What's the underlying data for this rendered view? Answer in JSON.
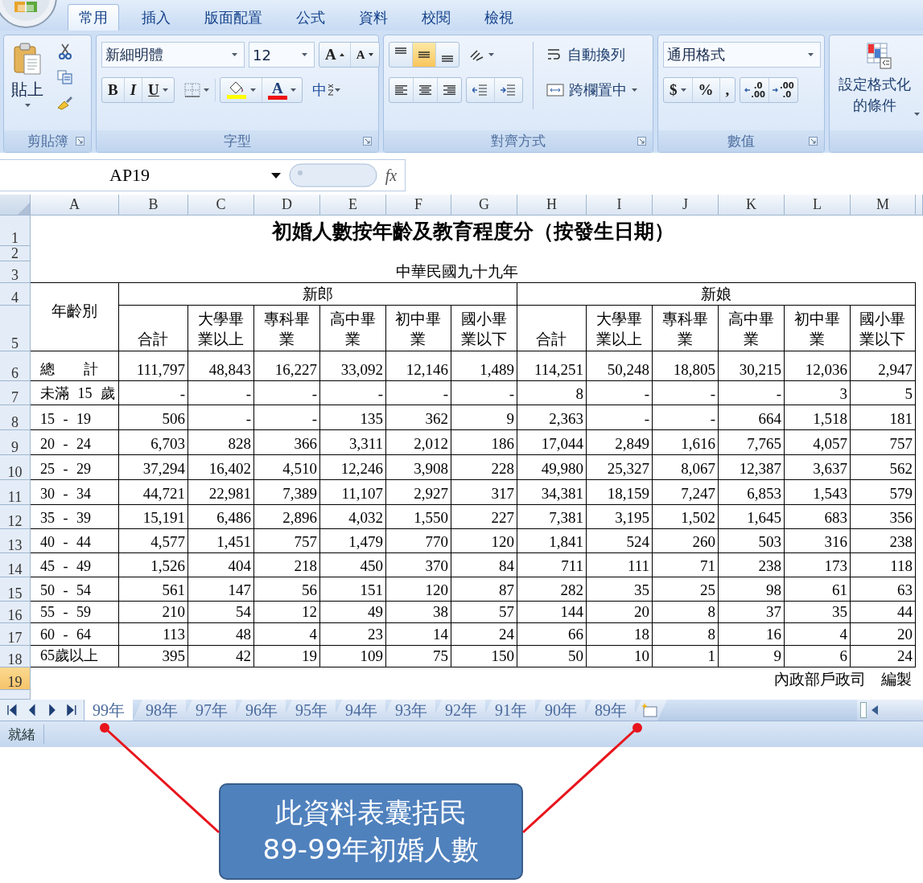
{
  "ribbon": {
    "tabs": [
      {
        "label": "常用",
        "selected": true
      },
      {
        "label": "插入",
        "selected": false
      },
      {
        "label": "版面配置",
        "selected": false
      },
      {
        "label": "公式",
        "selected": false
      },
      {
        "label": "資料",
        "selected": false
      },
      {
        "label": "校閱",
        "selected": false
      },
      {
        "label": "檢視",
        "selected": false
      }
    ],
    "clipboard": {
      "label": "剪貼簿",
      "paste": "貼上"
    },
    "font_group": {
      "label": "字型",
      "font_name": "新細明體",
      "font_size": "12",
      "grow": "A",
      "shrink": "A",
      "bold": "B",
      "italic": "I",
      "underline": "U",
      "font_color": "A",
      "phonetic": "中"
    },
    "alignment": {
      "label": "對齊方式",
      "vertical": [
        {
          "selected": false
        },
        {
          "selected": true
        },
        {
          "selected": false
        }
      ],
      "horizontal": [
        {
          "selected": false
        },
        {
          "selected": false
        },
        {
          "selected": false
        }
      ],
      "wrap_text": "自動換列",
      "merge_center": "跨欄置中"
    },
    "number": {
      "label": "數值",
      "format": "通用格式",
      "currency": "$",
      "percent": "%",
      "comma": ",",
      "decimals": [
        {
          "top": ".0",
          "bottom": ".00"
        },
        {
          "top": ".00",
          "bottom": ".0"
        }
      ]
    },
    "styles": {
      "conditional_format": "設定格式化的條件"
    }
  },
  "formula_bar": {
    "name_box": "AP19",
    "function_label": "fx"
  },
  "sheet": {
    "columns": [
      "A",
      "B",
      "C",
      "D",
      "E",
      "F",
      "G",
      "H",
      "I",
      "J",
      "K",
      "L",
      "M"
    ],
    "rows": [
      {
        "label": "1",
        "selected": false
      },
      {
        "label": "2",
        "selected": false
      },
      {
        "label": "3",
        "selected": false
      },
      {
        "label": "4",
        "selected": false
      },
      {
        "label": "5",
        "selected": false
      },
      {
        "label": "6",
        "selected": false
      },
      {
        "label": "7",
        "selected": false
      },
      {
        "label": "8",
        "selected": false
      },
      {
        "label": "9",
        "selected": false
      },
      {
        "label": "10",
        "selected": false
      },
      {
        "label": "11",
        "selected": false
      },
      {
        "label": "12",
        "selected": false
      },
      {
        "label": "13",
        "selected": false
      },
      {
        "label": "14",
        "selected": false
      },
      {
        "label": "15",
        "selected": false
      },
      {
        "label": "16",
        "selected": false
      },
      {
        "label": "17",
        "selected": false
      },
      {
        "label": "18",
        "selected": false
      },
      {
        "label": "19",
        "selected": true
      }
    ],
    "title": "初婚人數按年齡及教育程度分（按發生日期）",
    "subtitle": "中華民國九十九年",
    "age_header": "年齡別",
    "groups": [
      {
        "label": "新郎",
        "columns": [
          "合計",
          "大學畢業以上",
          "專科畢業",
          "高中畢業",
          "初中畢業",
          "國小畢業以下"
        ]
      },
      {
        "label": "新娘",
        "columns": [
          "合計",
          "大學畢業以上",
          "專科畢業",
          "高中畢業",
          "初中畢業",
          "國小畢業以下"
        ]
      }
    ],
    "data": [
      {
        "label": "總　　計",
        "values": [
          "111,797",
          "48,843",
          "16,227",
          "33,092",
          "12,146",
          "1,489",
          "114,251",
          "50,248",
          "18,805",
          "30,215",
          "12,036",
          "2,947"
        ]
      },
      {
        "label": "未滿 15 歲",
        "values": [
          "-",
          "-",
          "-",
          "-",
          "-",
          "-",
          "8",
          "-",
          "-",
          "-",
          "3",
          "5"
        ]
      },
      {
        "label": "15 - 19",
        "values": [
          "506",
          "-",
          "-",
          "135",
          "362",
          "9",
          "2,363",
          "-",
          "-",
          "664",
          "1,518",
          "181"
        ]
      },
      {
        "label": "20 - 24",
        "values": [
          "6,703",
          "828",
          "366",
          "3,311",
          "2,012",
          "186",
          "17,044",
          "2,849",
          "1,616",
          "7,765",
          "4,057",
          "757"
        ]
      },
      {
        "label": "25 - 29",
        "values": [
          "37,294",
          "16,402",
          "4,510",
          "12,246",
          "3,908",
          "228",
          "49,980",
          "25,327",
          "8,067",
          "12,387",
          "3,637",
          "562"
        ]
      },
      {
        "label": "30 - 34",
        "values": [
          "44,721",
          "22,981",
          "7,389",
          "11,107",
          "2,927",
          "317",
          "34,381",
          "18,159",
          "7,247",
          "6,853",
          "1,543",
          "579"
        ]
      },
      {
        "label": "35 - 39",
        "values": [
          "15,191",
          "6,486",
          "2,896",
          "4,032",
          "1,550",
          "227",
          "7,381",
          "3,195",
          "1,502",
          "1,645",
          "683",
          "356"
        ]
      },
      {
        "label": "40 - 44",
        "values": [
          "4,577",
          "1,451",
          "757",
          "1,479",
          "770",
          "120",
          "1,841",
          "524",
          "260",
          "503",
          "316",
          "238"
        ]
      },
      {
        "label": "45 - 49",
        "values": [
          "1,526",
          "404",
          "218",
          "450",
          "370",
          "84",
          "711",
          "111",
          "71",
          "238",
          "173",
          "118"
        ]
      },
      {
        "label": "50 - 54",
        "values": [
          "561",
          "147",
          "56",
          "151",
          "120",
          "87",
          "282",
          "35",
          "25",
          "98",
          "61",
          "63"
        ]
      },
      {
        "label": "55 - 59",
        "values": [
          "210",
          "54",
          "12",
          "49",
          "38",
          "57",
          "144",
          "20",
          "8",
          "37",
          "35",
          "44"
        ]
      },
      {
        "label": "60 - 64",
        "values": [
          "113",
          "48",
          "4",
          "23",
          "14",
          "24",
          "66",
          "18",
          "8",
          "16",
          "4",
          "20"
        ]
      },
      {
        "label": "65歲以上",
        "values": [
          "395",
          "42",
          "19",
          "109",
          "75",
          "150",
          "50",
          "10",
          "1",
          "9",
          "6",
          "24"
        ]
      }
    ],
    "footer": "內政部戶政司　編製"
  },
  "sheet_tabs": [
    {
      "label": "99年",
      "selected": true
    },
    {
      "label": "98年",
      "selected": false
    },
    {
      "label": "97年",
      "selected": false
    },
    {
      "label": "96年",
      "selected": false
    },
    {
      "label": "95年",
      "selected": false
    },
    {
      "label": "94年",
      "selected": false
    },
    {
      "label": "93年",
      "selected": false
    },
    {
      "label": "92年",
      "selected": false
    },
    {
      "label": "91年",
      "selected": false
    },
    {
      "label": "90年",
      "selected": false
    },
    {
      "label": "89年",
      "selected": false
    }
  ],
  "status_bar": {
    "text": "就緒"
  },
  "callout": {
    "text": "此資料表囊括民\n89-99年初婚人數"
  }
}
